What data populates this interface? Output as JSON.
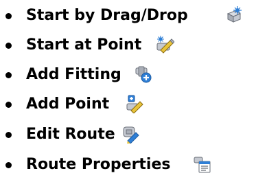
{
  "items": [
    {
      "label": "Start by Drag/Drop",
      "icon": "start-drag-drop-icon"
    },
    {
      "label": "Start at Point",
      "icon": "start-at-point-icon"
    },
    {
      "label": "Add Fitting",
      "icon": "add-fitting-icon"
    },
    {
      "label": "Add Point",
      "icon": "add-point-icon"
    },
    {
      "label": "Edit Route",
      "icon": "edit-route-icon"
    },
    {
      "label": "Route Properties",
      "icon": "route-properties-icon"
    }
  ],
  "colors": {
    "text": "#000000",
    "icon_body": "#b8bcc4",
    "icon_edge": "#6a6f78",
    "icon_accent_blue": "#2f7fd6",
    "icon_accent_yellow": "#e8c43a"
  }
}
